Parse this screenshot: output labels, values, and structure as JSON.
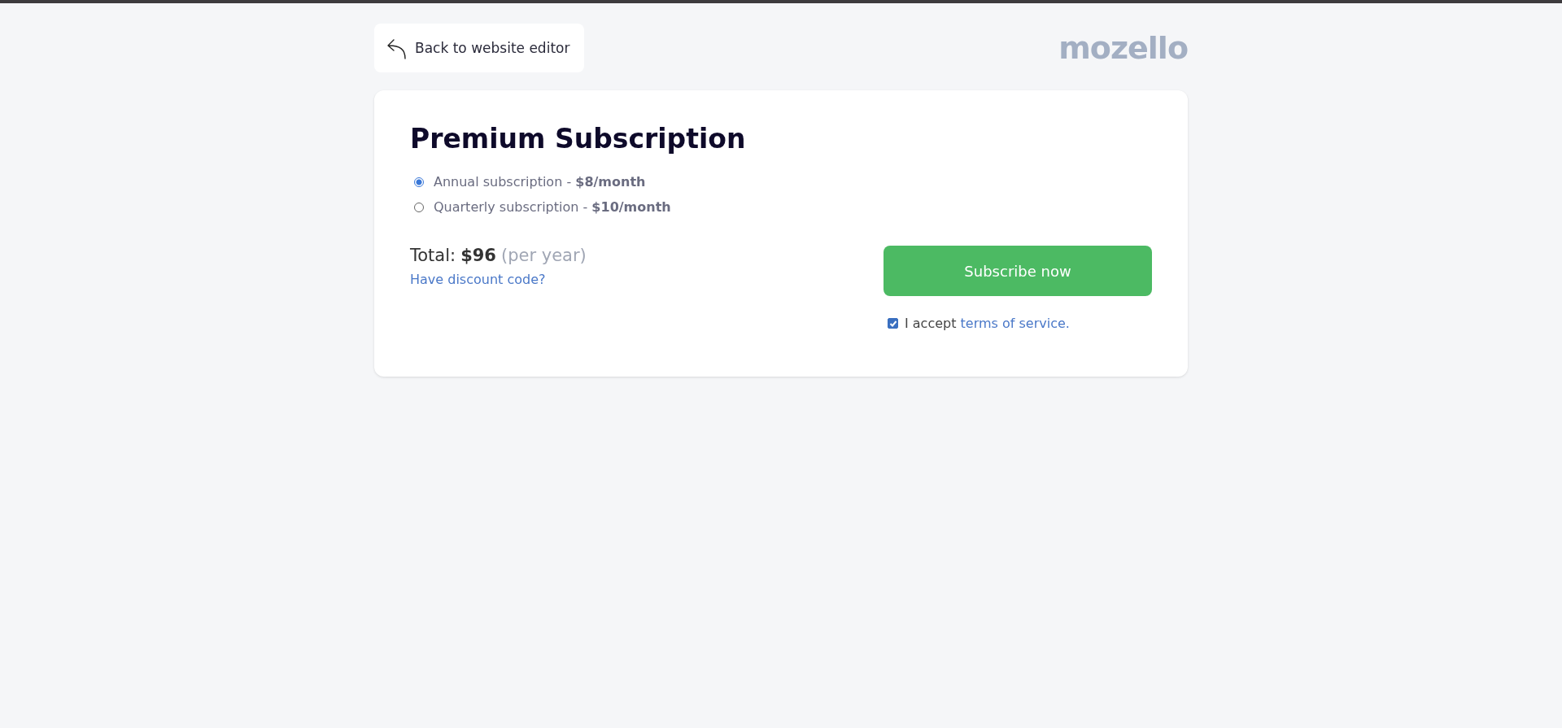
{
  "back_button": {
    "label": "Back to website editor"
  },
  "logo": {
    "text": "mozello"
  },
  "card": {
    "title": "Premium Subscription",
    "plans": [
      {
        "label": "Annual subscription - **$8/month**",
        "selected": true
      },
      {
        "label": "Quarterly subscription - **$10/month**",
        "selected": false
      }
    ],
    "total": {
      "label": "Total:",
      "amount": "$96",
      "period": "(per year)"
    },
    "discount_link": "Have discount code?",
    "subscribe_button": "Subscribe now",
    "terms": {
      "checked": true,
      "text": "I accept",
      "link": "terms of service."
    }
  }
}
